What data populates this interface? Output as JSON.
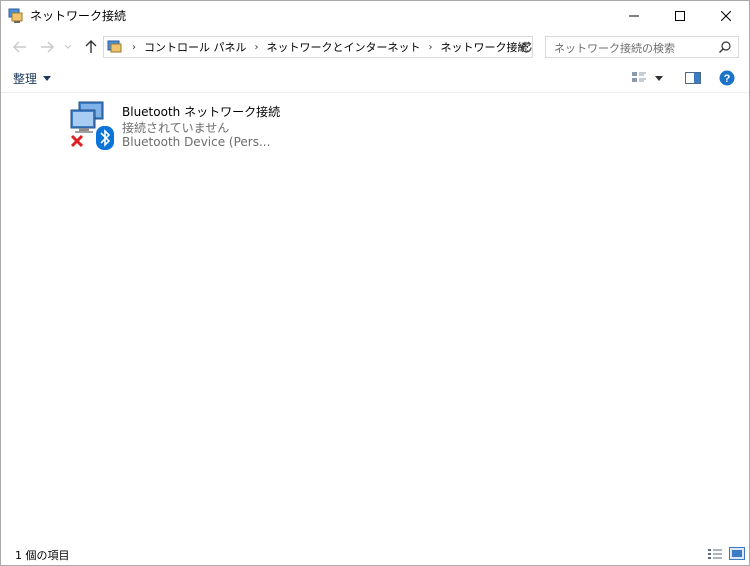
{
  "window": {
    "title": "ネットワーク接続"
  },
  "address": {
    "breadcrumbs": [
      "コントロール パネル",
      "ネットワークとインターネット",
      "ネットワーク接続"
    ]
  },
  "search": {
    "placeholder": "ネットワーク接続の検索"
  },
  "toolbar": {
    "organize_label": "整理"
  },
  "connections": [
    {
      "name": "Bluetooth ネットワーク接続",
      "status": "接続されていません",
      "device": "Bluetooth Device (Pers..."
    }
  ],
  "statusbar": {
    "item_count": "1 個の項目"
  },
  "icons": {
    "app": "network-connections-icon",
    "back": "back-arrow-icon",
    "forward": "forward-arrow-icon",
    "recent": "chevron-down-icon",
    "up": "up-arrow-icon",
    "refresh": "refresh-icon",
    "search": "search-icon",
    "help": "help-icon"
  },
  "colors": {
    "help_blue": "#1a73c9",
    "disconnected_red": "#e02020",
    "bluetooth_blue": "#0a74da",
    "organize_text": "#1e395b"
  }
}
